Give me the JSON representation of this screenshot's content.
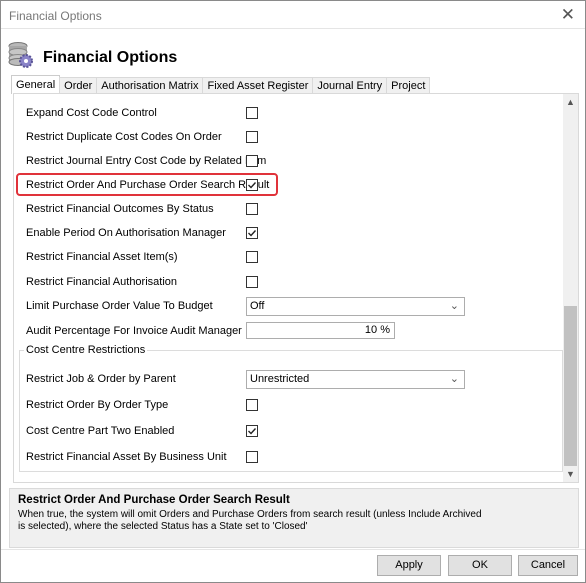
{
  "window": {
    "title": "Financial Options",
    "close_icon": "close-icon"
  },
  "header": {
    "title": "Financial Options",
    "icon": "database-gear-icon"
  },
  "tabs": [
    {
      "label": "General",
      "active": true
    },
    {
      "label": "Order"
    },
    {
      "label": "Authorisation Matrix"
    },
    {
      "label": "Fixed Asset Register"
    },
    {
      "label": "Journal Entry"
    },
    {
      "label": "Project"
    }
  ],
  "options": [
    {
      "label": "Expand Cost Code Control",
      "type": "checkbox",
      "checked": false
    },
    {
      "label": "Restrict Duplicate Cost Codes On Order",
      "type": "checkbox",
      "checked": false
    },
    {
      "label": "Restrict Journal Entry Cost Code by Related Item",
      "type": "checkbox",
      "checked": false
    },
    {
      "label": "Restrict Order And Purchase Order Search Result",
      "type": "checkbox",
      "checked": true,
      "highlighted": true
    },
    {
      "label": "Restrict Financial Outcomes By Status",
      "type": "checkbox",
      "checked": false
    },
    {
      "label": "Enable Period On Authorisation Manager",
      "type": "checkbox",
      "checked": true
    },
    {
      "label": "Restrict Financial Asset Item(s)",
      "type": "checkbox",
      "checked": false
    },
    {
      "label": "Restrict Financial Authorisation",
      "type": "checkbox",
      "checked": false
    },
    {
      "label": "Limit Purchase Order Value To Budget",
      "type": "select",
      "value": "Off"
    },
    {
      "label": "Audit Percentage For Invoice Audit Manager",
      "type": "percent",
      "value": "10 %"
    }
  ],
  "cost_centre": {
    "title": "Cost Centre Restrictions",
    "options": [
      {
        "label": "Restrict Job & Order by Parent",
        "type": "select",
        "value": "Unrestricted"
      },
      {
        "label": "Restrict Order By Order Type",
        "type": "checkbox",
        "checked": false
      },
      {
        "label": "Cost Centre Part Two Enabled",
        "type": "checkbox",
        "checked": true
      },
      {
        "label": "Restrict Financial Asset By Business Unit",
        "type": "checkbox",
        "checked": false
      }
    ]
  },
  "description": {
    "title": "Restrict Order And Purchase Order Search Result",
    "body": "When true, the system will omit Orders and Purchase Orders from search result (unless Include Archived is selected), where the selected Status has a State set to 'Closed'"
  },
  "buttons": {
    "apply": "Apply",
    "ok": "OK",
    "cancel": "Cancel"
  },
  "colors": {
    "highlight": "#e0323a"
  }
}
